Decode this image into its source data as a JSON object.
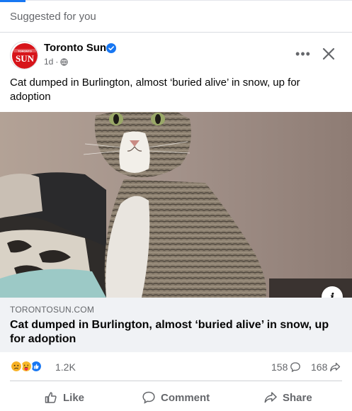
{
  "feed": {
    "section_label": "Suggested for you"
  },
  "post": {
    "page_name": "Toronto Sun",
    "timestamp": "1d",
    "meta_separator": "·",
    "text": "Cat dumped in Burlington, almost ‘buried alive’ in snow, up for adoption",
    "more_label": "•••",
    "avatar_small_text": "TORONTO",
    "avatar_text": "SUN"
  },
  "link": {
    "domain": "TORONTOSUN.COM",
    "title": "Cat dumped in Burlington, almost ‘buried alive’ in snow, up for adoption",
    "info_label": "i"
  },
  "stats": {
    "reaction_count": "1.2K",
    "comment_count": "158",
    "share_count": "168",
    "reaction_types": [
      "sad",
      "care",
      "like"
    ]
  },
  "actions": {
    "like": "Like",
    "comment": "Comment",
    "share": "Share"
  },
  "colors": {
    "accent": "#1877f2",
    "brand_red": "#d7141a",
    "secondary_text": "#65676b",
    "sad_yellow": "#f7b125",
    "care_yellow": "#f7b928"
  }
}
